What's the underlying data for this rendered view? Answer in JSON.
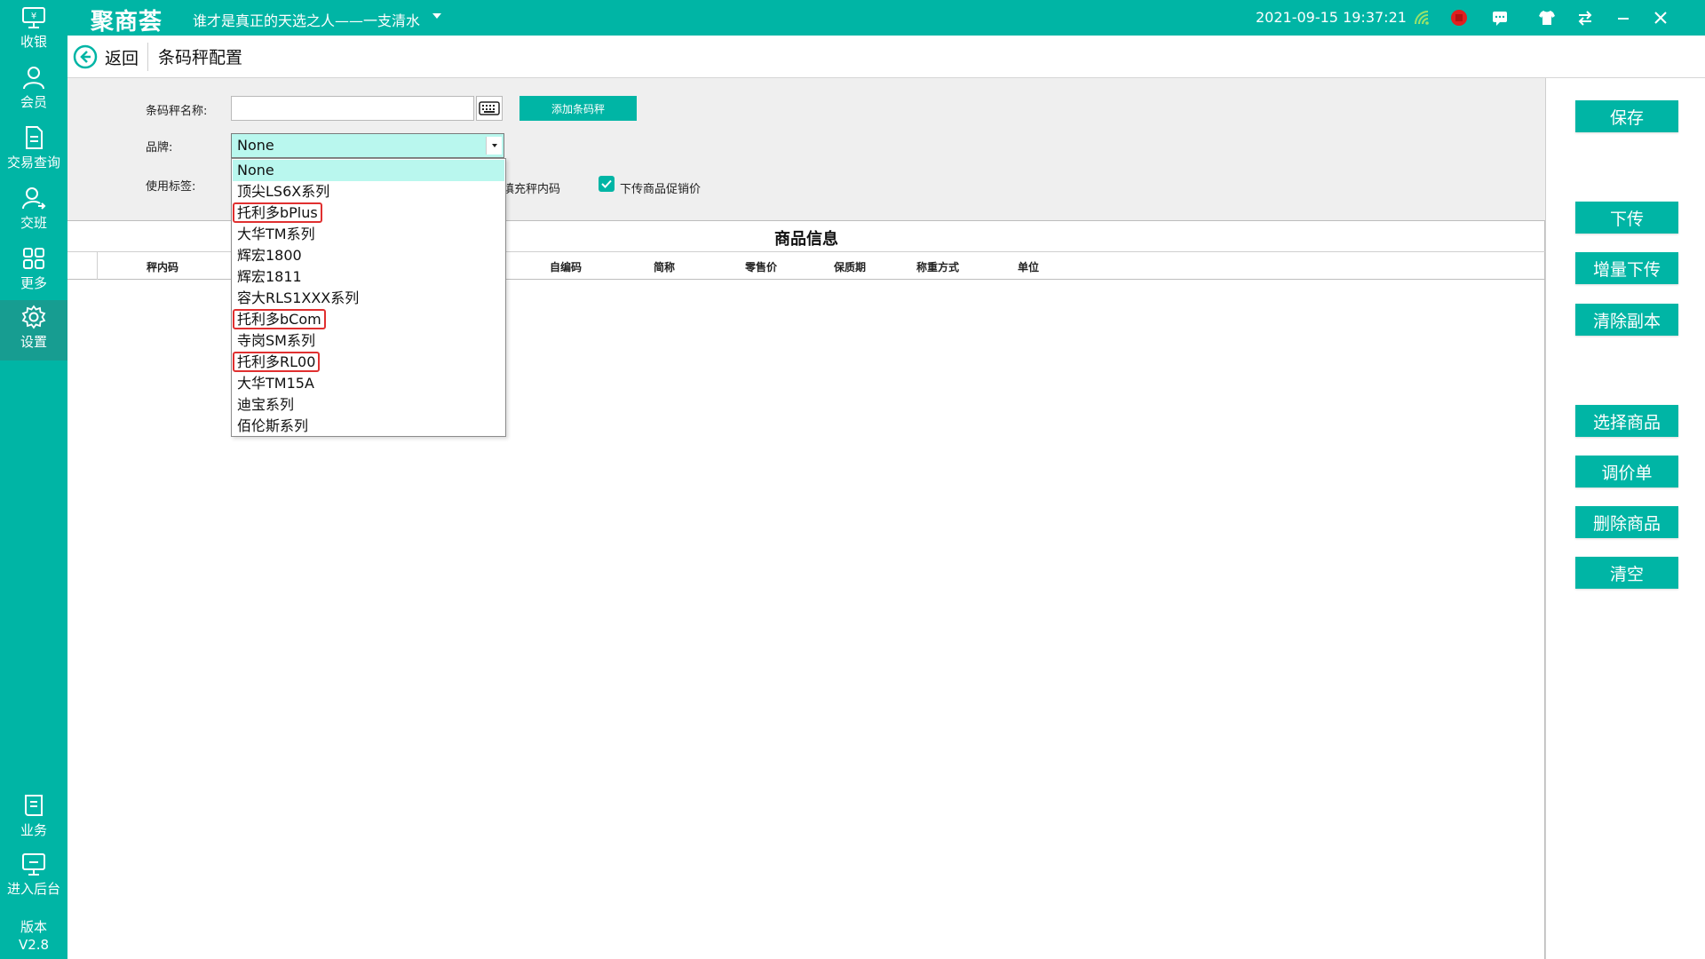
{
  "app": {
    "logo": "聚商荟",
    "subtitle": "谁才是真正的天选之人——一支清水",
    "datetime": "2021-09-15 19:37:21",
    "brand_color": "#00b5a5",
    "topbar_icons": [
      "wifi-signal-icon",
      "stop-record-icon",
      "message-icon",
      "shirt-skin-icon",
      "swap-icon",
      "minimize-icon",
      "close-icon"
    ]
  },
  "sidebar": {
    "items": [
      {
        "label": "收银",
        "icon": "cashier-monitor-icon"
      },
      {
        "label": "会员",
        "icon": "user-icon"
      },
      {
        "label": "交易查询",
        "icon": "document-icon"
      },
      {
        "label": "交班",
        "icon": "shift-handover-icon"
      },
      {
        "label": "更多",
        "icon": "grid-icon"
      },
      {
        "label": "设置",
        "icon": "gear-icon",
        "active": true
      },
      {
        "label": "业务",
        "icon": "book-icon"
      },
      {
        "label": "进入后台",
        "icon": "monitor-icon"
      }
    ],
    "version_label": "版本",
    "version": "V2.8"
  },
  "header": {
    "back_label": "返回",
    "title": "条码秤配置"
  },
  "form": {
    "name_label": "条码秤名称:",
    "name_value": "",
    "add_button": "添加条码秤",
    "brand_label": "品牌:",
    "brand_value": "None",
    "label_label": "使用标签:",
    "fill_code_label": "填充秤内码",
    "upload_promo_label": "下传商品促销价",
    "upload_promo_checked": true
  },
  "brand_options": [
    {
      "label": "None",
      "selected": true
    },
    {
      "label": "顶尖LS6X系列"
    },
    {
      "label": "托利多bPlus",
      "highlighted": true
    },
    {
      "label": "大华TM系列"
    },
    {
      "label": "辉宏1800"
    },
    {
      "label": "辉宏1811"
    },
    {
      "label": "容大RLS1XXX系列"
    },
    {
      "label": "托利多bCom",
      "highlighted": true
    },
    {
      "label": "寺岗SM系列"
    },
    {
      "label": "托利多RL00",
      "highlighted": true
    },
    {
      "label": "大华TM15A"
    },
    {
      "label": "迪宝系列"
    },
    {
      "label": "佰伦斯系列"
    }
  ],
  "table": {
    "caption": "商品信息",
    "columns": [
      "秤内码",
      "自编码",
      "简称",
      "零售价",
      "保质期",
      "称重方式",
      "单位"
    ],
    "rows": []
  },
  "actions": {
    "save": "保存",
    "upload": "下传",
    "incremental_upload": "增量下传",
    "clear_copy": "清除副本",
    "select_goods": "选择商品",
    "price_adjust": "调价单",
    "delete_goods": "删除商品",
    "clear_all": "清空"
  }
}
